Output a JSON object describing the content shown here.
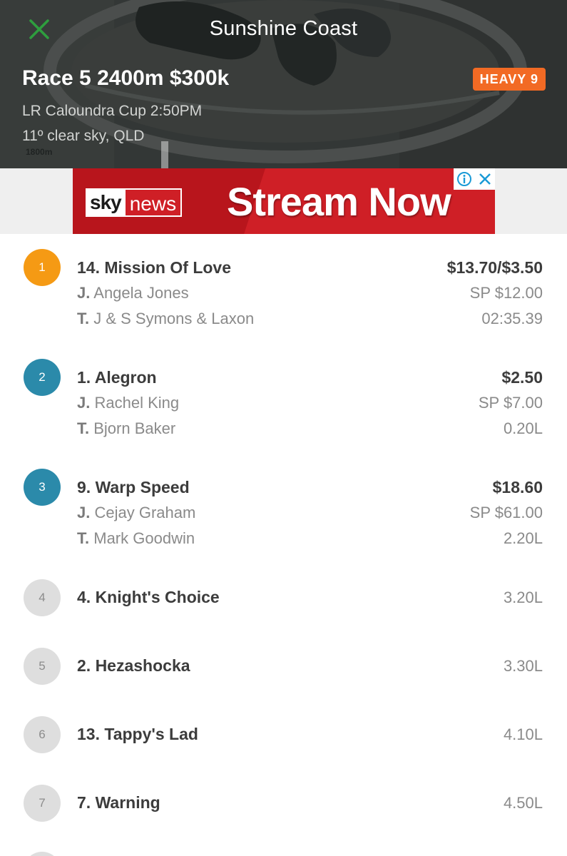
{
  "header": {
    "title": "Sunshine Coast",
    "race_title": "Race 5 2400m $300k",
    "track_condition": "HEAVY 9",
    "race_name": "LR Caloundra Cup 2:50PM",
    "weather": "11º clear sky, QLD",
    "distance_marker": "1800m",
    "colors": {
      "badge": "#f26a24",
      "close_icon": "#2e9e3e"
    }
  },
  "ad": {
    "logo_sky": "sky",
    "logo_news": "news",
    "headline": "Stream Now",
    "icons": [
      "info-icon",
      "close-icon"
    ]
  },
  "labels": {
    "jockey_prefix": "J.",
    "trainer_prefix": "T."
  },
  "results": [
    {
      "position": "1",
      "horse": "14. Mission Of Love",
      "odds": "$13.70/$3.50",
      "jockey": "Angela Jones",
      "sp": "SP $12.00",
      "trainer": "J & S Symons & Laxon",
      "margin": "02:35.39",
      "color": "gold"
    },
    {
      "position": "2",
      "horse": "1. Alegron",
      "odds": "$2.50",
      "jockey": "Rachel King",
      "sp": "SP $7.00",
      "trainer": "Bjorn Baker",
      "margin": "0.20L",
      "color": "blue"
    },
    {
      "position": "3",
      "horse": "9. Warp Speed",
      "odds": "$18.60",
      "jockey": "Cejay Graham",
      "sp": "SP $61.00",
      "trainer": "Mark Goodwin",
      "margin": "2.20L",
      "color": "blue"
    },
    {
      "position": "4",
      "horse": "4. Knight's Choice",
      "margin": "3.20L"
    },
    {
      "position": "5",
      "horse": "2. Hezashocka",
      "margin": "3.30L"
    },
    {
      "position": "6",
      "horse": "13. Tappy's Lad",
      "margin": "4.10L"
    },
    {
      "position": "7",
      "horse": "7. Warning",
      "margin": "4.50L"
    }
  ]
}
